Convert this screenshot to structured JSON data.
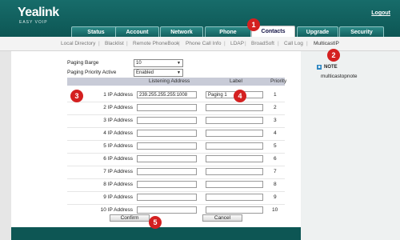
{
  "header": {
    "logo": "Yealink",
    "logo_sub": "EASY VOIP",
    "logout": "Logout",
    "tabs": [
      "Status",
      "Account",
      "Network",
      "Phone",
      "Contacts",
      "Upgrade",
      "Security"
    ],
    "active_tab": "Contacts"
  },
  "subnav": {
    "items": [
      "Local Directory",
      "Blacklist",
      "Remote PhoneBook",
      "Phone Call Info",
      "LDAP",
      "BroadSoft",
      "Call Log",
      "MulticastIP"
    ],
    "active": "MulticastIP"
  },
  "form": {
    "paging_barge_label": "Paging Barge",
    "paging_barge_value": "10",
    "paging_priority_label": "Paging Priority Active",
    "paging_priority_value": "Enabled"
  },
  "table": {
    "headers": [
      "Listening Address",
      "Label",
      "Priority"
    ],
    "rows": [
      {
        "label": "1 IP Address",
        "address": "239.255.255.255:1008",
        "name": "Paging 1",
        "priority": "1"
      },
      {
        "label": "2 IP Address",
        "address": "",
        "name": "",
        "priority": "2"
      },
      {
        "label": "3 IP Address",
        "address": "",
        "name": "",
        "priority": "3"
      },
      {
        "label": "4 IP Address",
        "address": "",
        "name": "",
        "priority": "4"
      },
      {
        "label": "5 IP Address",
        "address": "",
        "name": "",
        "priority": "5"
      },
      {
        "label": "6 IP Address",
        "address": "",
        "name": "",
        "priority": "6"
      },
      {
        "label": "7 IP Address",
        "address": "",
        "name": "",
        "priority": "7"
      },
      {
        "label": "8 IP Address",
        "address": "",
        "name": "",
        "priority": "8"
      },
      {
        "label": "9 IP Address",
        "address": "",
        "name": "",
        "priority": "9"
      },
      {
        "label": "10 IP Address",
        "address": "",
        "name": "",
        "priority": "10"
      }
    ]
  },
  "buttons": {
    "confirm": "Confirm",
    "cancel": "Cancel"
  },
  "note": {
    "icon": "note-icon",
    "title": "NOTE",
    "text": "multicastopnote"
  },
  "callouts": [
    "1",
    "2",
    "3",
    "4",
    "5"
  ],
  "colors": {
    "brand": "#0d5654",
    "callout": "#d42020",
    "table_header": "#c8cbd7"
  }
}
